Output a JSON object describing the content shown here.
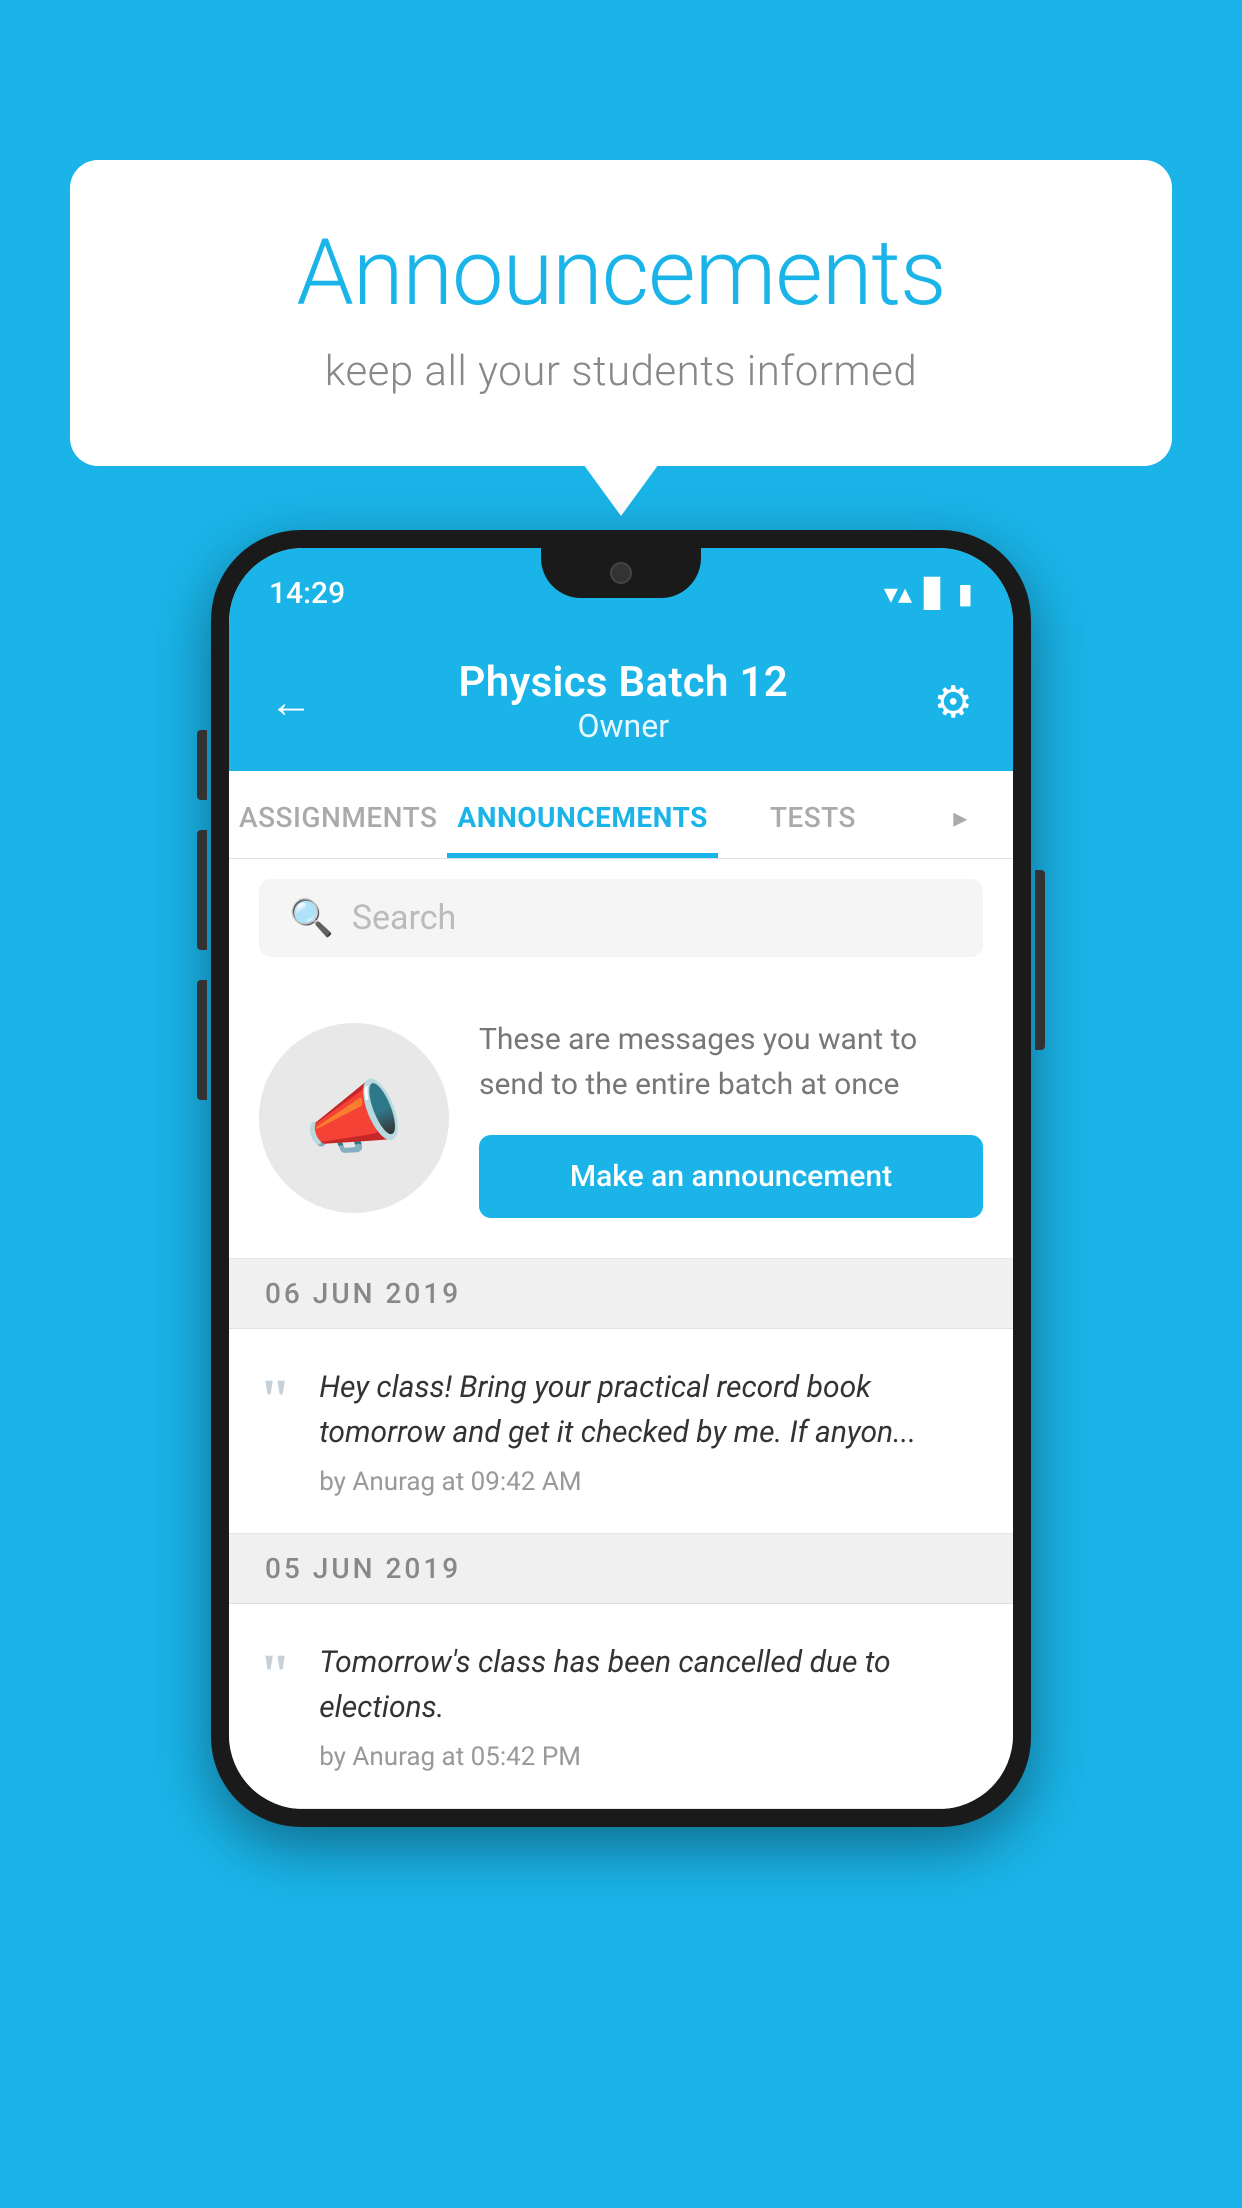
{
  "bubble": {
    "title": "Announcements",
    "subtitle": "keep all your students informed"
  },
  "phone": {
    "statusBar": {
      "time": "14:29"
    },
    "header": {
      "title": "Physics Batch 12",
      "subtitle": "Owner",
      "backLabel": "←",
      "gearLabel": "⚙"
    },
    "tabs": [
      {
        "label": "ASSIGNMENTS",
        "active": false
      },
      {
        "label": "ANNOUNCEMENTS",
        "active": true
      },
      {
        "label": "TESTS",
        "active": false
      },
      {
        "label": "",
        "active": false,
        "partial": true
      }
    ],
    "search": {
      "placeholder": "Search"
    },
    "promo": {
      "description": "These are messages you want to send to the entire batch at once",
      "buttonLabel": "Make an announcement"
    },
    "dates": [
      {
        "label": "06  JUN  2019",
        "announcements": [
          {
            "text": "Hey class! Bring your practical record book tomorrow and get it checked by me. If anyon...",
            "meta": "by Anurag at 09:42 AM"
          }
        ]
      },
      {
        "label": "05  JUN  2019",
        "announcements": [
          {
            "text": "Tomorrow's class has been cancelled due to elections.",
            "meta": "by Anurag at 05:42 PM"
          }
        ]
      }
    ]
  }
}
